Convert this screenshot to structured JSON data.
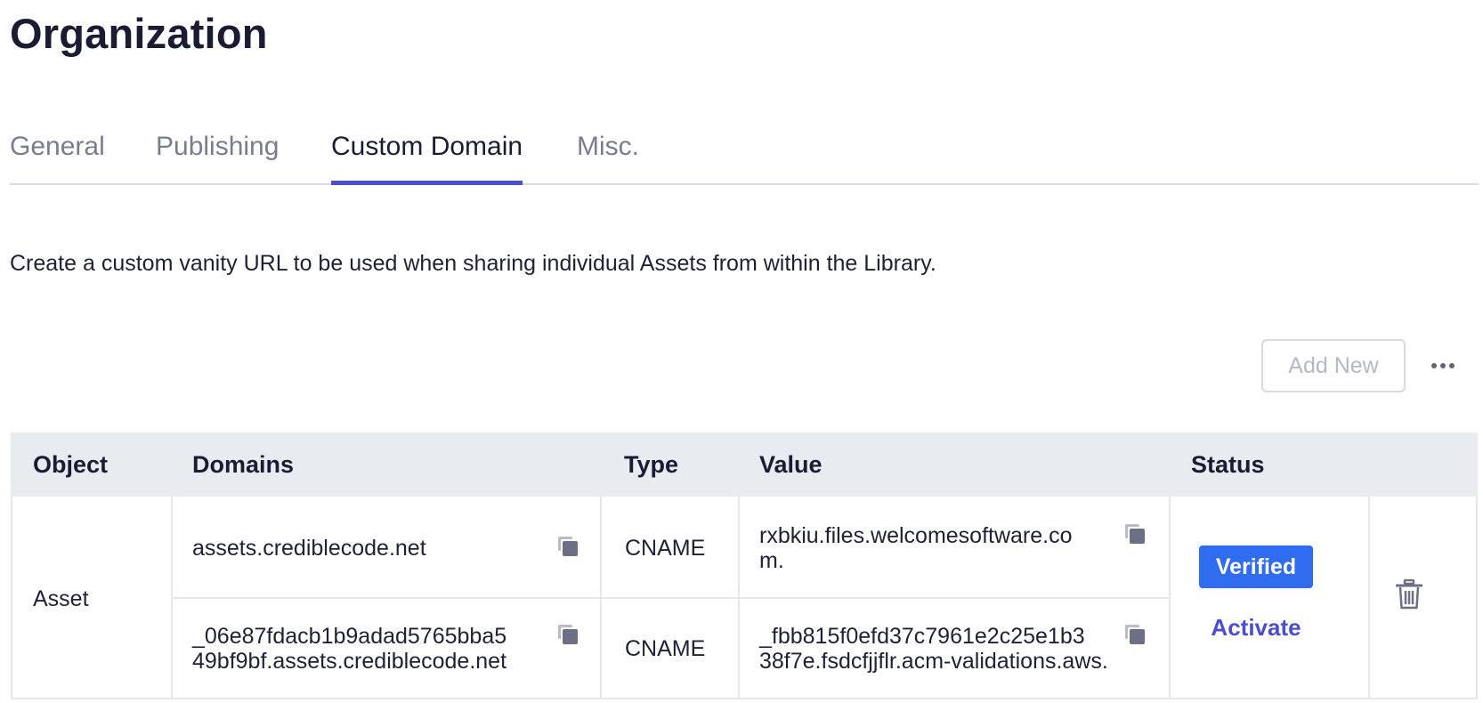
{
  "page": {
    "title": "Organization"
  },
  "tabs": [
    {
      "label": "General",
      "active": false
    },
    {
      "label": "Publishing",
      "active": false
    },
    {
      "label": "Custom Domain",
      "active": true
    },
    {
      "label": "Misc.",
      "active": false
    }
  ],
  "description": "Create a custom vanity URL to be used when sharing individual Assets from within the Library.",
  "toolbar": {
    "add_new_label": "Add New",
    "more_icon": "more-horizontal-icon"
  },
  "table": {
    "headers": {
      "object": "Object",
      "domains": "Domains",
      "type": "Type",
      "value": "Value",
      "status": "Status"
    },
    "group": {
      "object": "Asset",
      "rows": [
        {
          "domain_line1": "assets.crediblecode.net",
          "domain_line2": "",
          "type": "CNAME",
          "value_line1": "rxbkiu.files.welcomesoftware.co",
          "value_line2": "m."
        },
        {
          "domain_line1": "_06e87fdacb1b9adad5765bba5",
          "domain_line2": "49bf9bf.assets.crediblecode.net",
          "type": "CNAME",
          "value_line1": "_fbb815f0efd37c7961e2c25e1b3",
          "value_line2": "38f7e.fsdcfjjflr.acm-validations.aws."
        }
      ],
      "status_badge": "Verified",
      "action_label": "Activate"
    },
    "icons": {
      "copy": "copy-icon",
      "delete": "trash-icon"
    }
  },
  "colors": {
    "accent": "#4b4ed0",
    "badge_bg": "#2f6cf0",
    "header_bg": "#e8ebef",
    "text": "#1b1c34",
    "muted_tab": "#7a7d90"
  }
}
